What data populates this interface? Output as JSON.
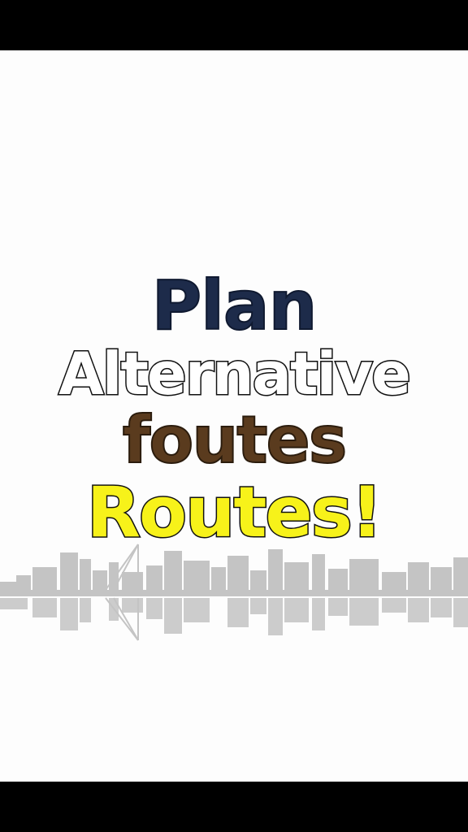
{
  "title": {
    "line1": "Plan",
    "line2": "Alternative",
    "line3": "foutes",
    "line4": "Routes!"
  },
  "colors": {
    "line1": "#1d2b4a",
    "line2": "#ffffff",
    "line3": "#5a3b1e",
    "line4": "#f7f21a",
    "skyline": "#c4c4c4",
    "background": "#fdfdfd",
    "letterbox": "#000000"
  },
  "illustration": {
    "icon": "city-skyline-reflection-icon"
  }
}
